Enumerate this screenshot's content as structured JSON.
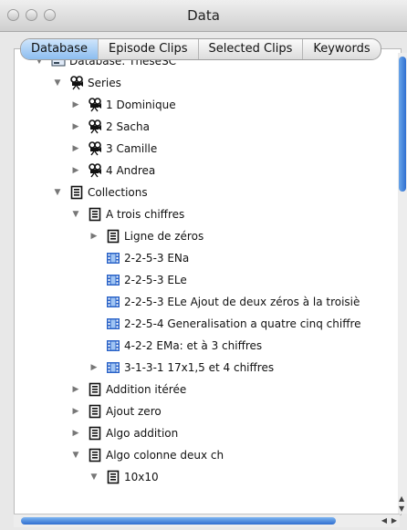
{
  "window": {
    "title": "Data"
  },
  "tabs": [
    "Database",
    "Episode Clips",
    "Selected Clips",
    "Keywords"
  ],
  "tree": [
    {
      "label": "Database: TheseSC",
      "level": 0,
      "expand": "open",
      "icon": "database-icon"
    },
    {
      "label": "Series",
      "level": 1,
      "expand": "open",
      "icon": "camera-icon"
    },
    {
      "label": "1 Dominique",
      "level": 2,
      "expand": "closed",
      "icon": "camera-icon"
    },
    {
      "label": "2 Sacha",
      "level": 2,
      "expand": "closed",
      "icon": "camera-icon"
    },
    {
      "label": "3 Camille",
      "level": 2,
      "expand": "closed",
      "icon": "camera-icon"
    },
    {
      "label": "4 Andrea",
      "level": 2,
      "expand": "closed",
      "icon": "camera-icon"
    },
    {
      "label": "Collections",
      "level": 1,
      "expand": "open",
      "icon": "collection-icon"
    },
    {
      "label": "A trois chiffres",
      "level": 2,
      "expand": "open",
      "icon": "collection-icon"
    },
    {
      "label": "Ligne de zéros",
      "level": 3,
      "expand": "closed",
      "icon": "collection-icon"
    },
    {
      "label": "2-2-5-3 ENa",
      "level": 3,
      "expand": "none",
      "icon": "clip-icon"
    },
    {
      "label": "2-2-5-3 ELe",
      "level": 3,
      "expand": "none",
      "icon": "clip-icon"
    },
    {
      "label": "2-2-5-3 ELe Ajout de deux zéros à la troisiè",
      "level": 3,
      "expand": "none",
      "icon": "clip-icon"
    },
    {
      "label": "2-2-5-4 Generalisation a quatre cinq chiffre",
      "level": 3,
      "expand": "none",
      "icon": "clip-icon"
    },
    {
      "label": "4-2-2 EMa: et à 3 chiffres",
      "level": 3,
      "expand": "none",
      "icon": "clip-icon"
    },
    {
      "label": "3-1-3-1 17x1,5 et 4 chiffres",
      "level": 3,
      "expand": "closed",
      "icon": "clip-icon"
    },
    {
      "label": "Addition itérée",
      "level": 2,
      "expand": "closed",
      "icon": "collection-icon"
    },
    {
      "label": "Ajout zero",
      "level": 2,
      "expand": "closed",
      "icon": "collection-icon"
    },
    {
      "label": "Algo addition",
      "level": 2,
      "expand": "closed",
      "icon": "collection-icon"
    },
    {
      "label": "Algo colonne deux ch",
      "level": 2,
      "expand": "open",
      "icon": "collection-icon"
    },
    {
      "label": "10x10",
      "level": 3,
      "expand": "open",
      "icon": "collection-icon"
    }
  ]
}
